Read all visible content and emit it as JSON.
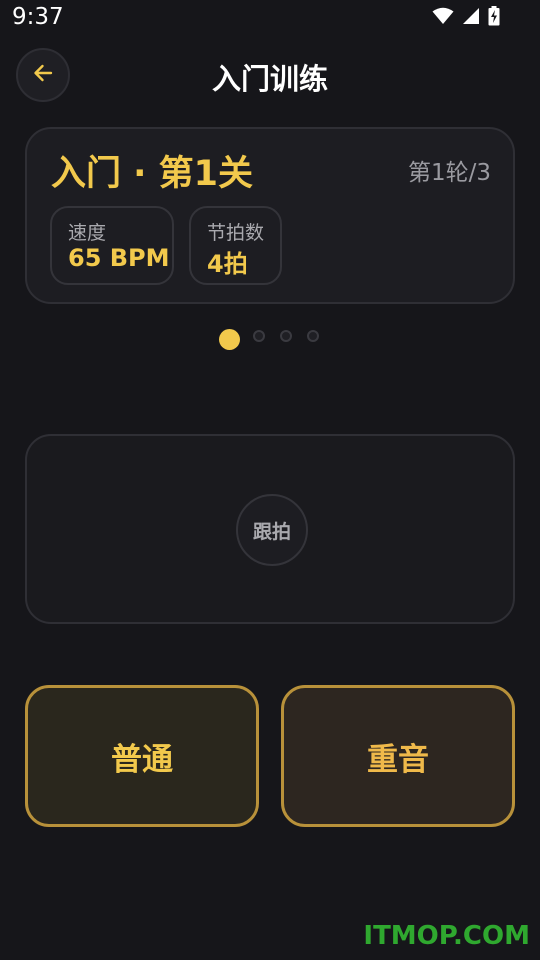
{
  "status_bar": {
    "time": "9:37",
    "icons": [
      "wifi-icon",
      "cell-signal-icon",
      "battery-charging-icon"
    ]
  },
  "header": {
    "title": "入门训练",
    "back_icon": "arrow-left-icon"
  },
  "level_card": {
    "title": "入门 · 第1关",
    "round": "第1轮/3",
    "stats": [
      {
        "label": "速度",
        "value": "65 BPM"
      },
      {
        "label": "节拍数",
        "value": "4拍"
      }
    ]
  },
  "pager": {
    "count": 4,
    "active_index": 0
  },
  "tap_area": {
    "button_label": "跟拍"
  },
  "actions": {
    "normal_label": "普通",
    "accent_label": "重音"
  },
  "watermark": "ITMOP.COM",
  "colors": {
    "background": "#16161a",
    "accent_yellow": "#f2c94c",
    "accent_border": "#b8913a",
    "muted_text": "#9a9aa0",
    "watermark_green": "#2fa82f"
  }
}
